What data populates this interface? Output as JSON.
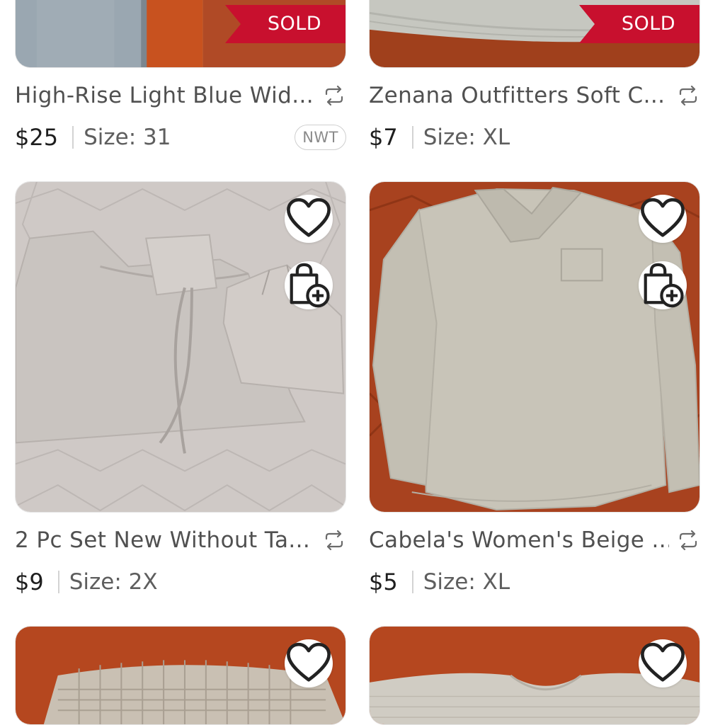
{
  "listings": [
    {
      "title": "High-Rise Light Blue Wid...",
      "price": "$25",
      "size": "Size: 31",
      "badge": "NWT",
      "status": "SOLD"
    },
    {
      "title": "Zenana Outfitters Soft C...",
      "price": "$7",
      "size": "Size: XL",
      "status": "SOLD"
    },
    {
      "title": "2 Pc Set New Without Ta...",
      "price": "$9",
      "size": "Size: 2X"
    },
    {
      "title": "Cabela's Women's Beige ...",
      "price": "$5",
      "size": "Size: XL"
    }
  ],
  "icons": {
    "like": "heart-icon",
    "bag": "add-to-bag-icon",
    "share": "share-icon"
  },
  "colors": {
    "sold_ribbon": "#c8102e",
    "background": "#ffffff",
    "backdrop": "#b04a26"
  }
}
